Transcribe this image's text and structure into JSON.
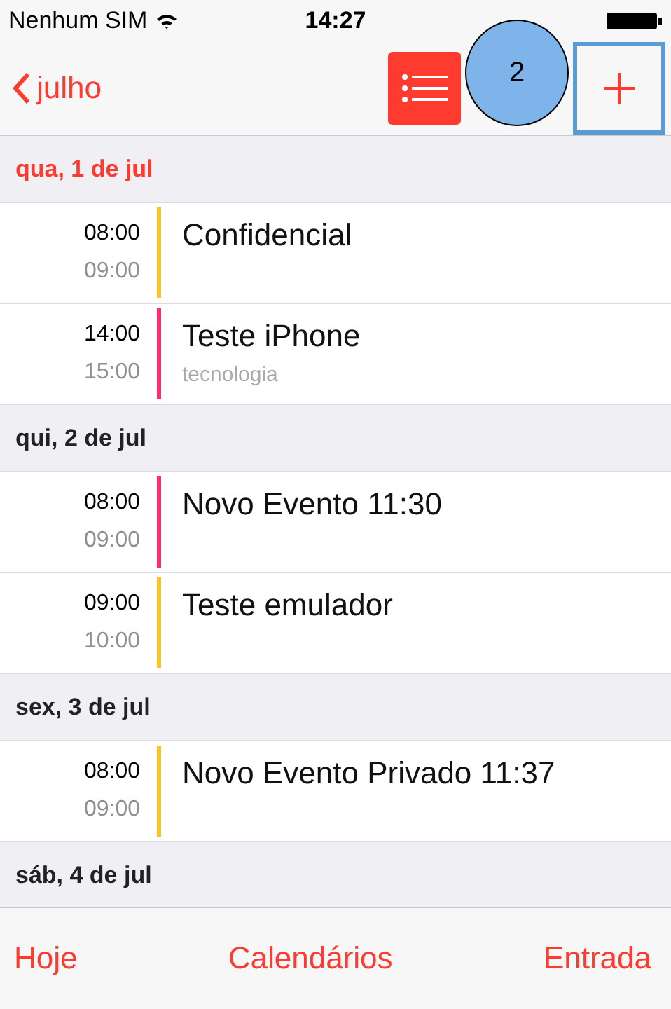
{
  "status_bar": {
    "carrier": "Nenhum SIM",
    "time": "14:27"
  },
  "nav": {
    "back_label": "julho",
    "badge": "2"
  },
  "days": [
    {
      "header": "qua, 1 de jul",
      "events": [
        {
          "start": "08:00",
          "end": "09:00",
          "title": "Confidencial",
          "color": "#f7c325"
        },
        {
          "start": "14:00",
          "end": "15:00",
          "title": "Teste iPhone",
          "subtitle": "tecnologia",
          "color": "#ff2d6f"
        }
      ]
    },
    {
      "header": "qui, 2 de jul",
      "events": [
        {
          "start": "08:00",
          "end": "09:00",
          "title": "Novo Evento 11:30",
          "color": "#ff2d6f"
        },
        {
          "start": "09:00",
          "end": "10:00",
          "title": "Teste emulador",
          "color": "#f7c325"
        }
      ]
    },
    {
      "header": "sex, 3 de jul",
      "events": [
        {
          "start": "08:00",
          "end": "09:00",
          "title": "Novo Evento Privado 11:37",
          "color": "#f7c325"
        }
      ]
    },
    {
      "header": "sáb, 4 de jul"
    }
  ],
  "tab_bar": [
    "Hoje",
    "Calendários",
    "Entrada"
  ]
}
